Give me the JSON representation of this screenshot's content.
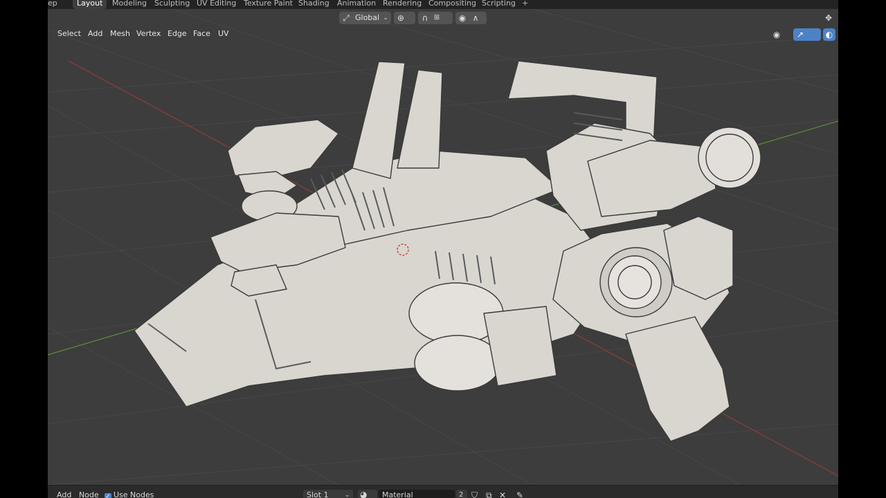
{
  "top_left_fragment": "ep",
  "workspace_tabs": [
    "Layout",
    "Modeling",
    "Sculpting",
    "UV Editing",
    "Texture Paint",
    "Shading",
    "Animation",
    "Rendering",
    "Compositing",
    "Scripting"
  ],
  "add_workspace_symbol": "+",
  "header": {
    "orientation": "Global",
    "edit_menu": [
      "Select",
      "Add",
      "Mesh",
      "Vertex",
      "Edge",
      "Face",
      "UV"
    ]
  },
  "node_bar": {
    "add": "Add",
    "node": "Node",
    "use_nodes": "Use Nodes",
    "slot": "Slot 1",
    "material": "Material",
    "users": "2"
  },
  "icons": {
    "transform_orientation": "transform-orientation-icon",
    "pivot": "pivot-icon",
    "snap": "snap-magnet-icon",
    "proportional": "proportional-edit-icon",
    "visibility": "eye-visibility-icon",
    "gizmo": "gizmo-icon",
    "overlay": "overlay-icon",
    "maximize": "maximize-icon",
    "material_browse": "material-sphere-icon",
    "fake_user": "shield-fake-user-icon",
    "copy": "copy-icon",
    "unlink": "close-icon",
    "pin": "pin-icon"
  },
  "colors": {
    "accent_blue": "#4d82c7",
    "x_axis": "#8f3a3a",
    "y_axis": "#5a8a3a",
    "grid": "#464646",
    "model": "#d9d6d0"
  }
}
